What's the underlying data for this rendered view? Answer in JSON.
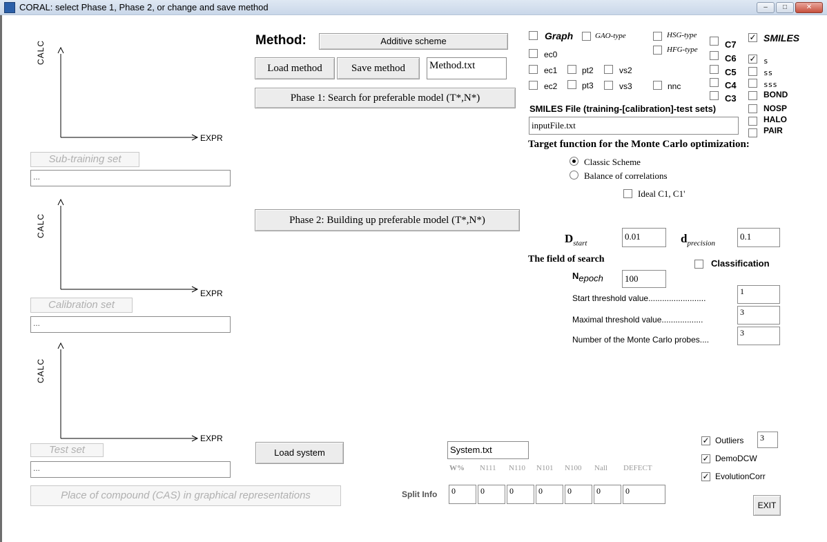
{
  "window": {
    "title": "CORAL: select Phase 1, Phase 2, or change and save method",
    "min_label": "–",
    "max_label": "□",
    "close_label": "✕"
  },
  "plots": [
    {
      "ylabel": "CALC",
      "xlabel": "EXPR",
      "set_label": "Sub-training set",
      "field_value": "..."
    },
    {
      "ylabel": "CALC",
      "xlabel": "EXPR",
      "set_label": "Calibration set",
      "field_value": "..."
    },
    {
      "ylabel": "CALC",
      "xlabel": "EXPR",
      "set_label": "Test set",
      "field_value": "..."
    }
  ],
  "place_button": "Place of compound (CAS) in graphical representations",
  "method": {
    "label": "Method:",
    "scheme_button": "Additive scheme",
    "load_button": "Load method",
    "save_button": "Save method",
    "filename": "Method.txt",
    "phase1_button": "Phase 1: Search for preferable model (T*,N*)",
    "phase2_button": "Phase 2: Building up preferable model (T*,N*)"
  },
  "options": {
    "graph": {
      "label": "Graph",
      "checked": false
    },
    "gao": {
      "label": "GAO-type",
      "checked": false
    },
    "hsg": {
      "label": "HSG-type",
      "checked": false
    },
    "hfg": {
      "label": "HFG-type",
      "checked": false
    },
    "ec0": {
      "label": "ec0",
      "checked": false
    },
    "ec1": {
      "label": "ec1",
      "checked": false
    },
    "ec2": {
      "label": "ec2",
      "checked": false
    },
    "pt2": {
      "label": "pt2",
      "checked": false
    },
    "pt3": {
      "label": "pt3",
      "checked": false
    },
    "vs2": {
      "label": "vs2",
      "checked": false
    },
    "vs3": {
      "label": "vs3",
      "checked": false
    },
    "nnc": {
      "label": "nnc",
      "checked": false
    },
    "c7": {
      "label": "C7",
      "checked": false
    },
    "c6": {
      "label": "C6",
      "checked": false
    },
    "c5": {
      "label": "C5",
      "checked": false
    },
    "c4": {
      "label": "C4",
      "checked": false
    },
    "c3": {
      "label": "C3",
      "checked": false
    },
    "smiles": {
      "label": "SMILES",
      "checked": true
    },
    "s": {
      "label": "s",
      "checked": true
    },
    "ss": {
      "label": "ss",
      "checked": false
    },
    "sss": {
      "label": "sss",
      "checked": false
    },
    "bond": {
      "label": "BOND",
      "checked": false
    },
    "nosp": {
      "label": "NOSP",
      "checked": false
    },
    "halo": {
      "label": "HALO",
      "checked": false
    },
    "pair": {
      "label": "PAIR",
      "checked": false
    }
  },
  "smiles_file": {
    "label": "SMILES File (training-[calibration]-test sets)",
    "value": "inputFile.txt"
  },
  "target": {
    "heading": "Target function for the Monte Carlo optimization:",
    "classic": "Classic Scheme",
    "balance": "Balance of correlations",
    "selected": "classic",
    "ideal_label": "Ideal C1, C1'",
    "ideal_checked": false
  },
  "params": {
    "d_start_label": "D",
    "d_start_sub": "start",
    "d_start_value": "0.01",
    "d_precision_label": "d",
    "d_precision_sub": "precision",
    "d_precision_value": "0.1",
    "field_heading": "The field of search",
    "classification_label": "Classification",
    "classification_checked": false,
    "n_epoch_label": "N",
    "n_epoch_sub": "epoch",
    "n_epoch_value": "100",
    "start_threshold_label": "Start threshold value.........................",
    "start_threshold_value": "1",
    "max_threshold_label": "Maximal threshold value..................",
    "max_threshold_value": "3",
    "probes_label": "Number of the Monte Carlo probes....",
    "probes_value": "3"
  },
  "system": {
    "load_button": "Load system",
    "filename": "System.txt",
    "columns": [
      "W%",
      "N111",
      "N110",
      "N101",
      "N100",
      "Nall",
      "DEFECT"
    ],
    "split_label": "Split Info",
    "split_values": [
      "0",
      "0",
      "0",
      "0",
      "0",
      "0",
      "0"
    ]
  },
  "flags": {
    "outliers": {
      "label": "Outliers",
      "checked": true,
      "value": "3"
    },
    "demodcw": {
      "label": "DemoDCW",
      "checked": true
    },
    "evolution": {
      "label": "EvolutionCorr",
      "checked": true
    }
  },
  "exit_button": "EXIT"
}
